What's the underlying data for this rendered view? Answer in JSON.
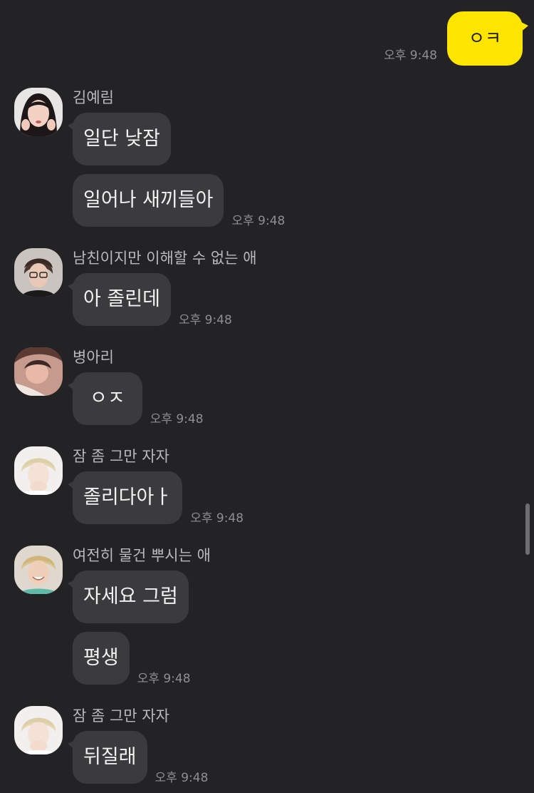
{
  "outgoing": {
    "text": "ㅇㅋ",
    "time": "오후 9:48"
  },
  "groups": [
    {
      "sender": "김예림",
      "avatar_icon": "profile-photo-girl",
      "messages": [
        {
          "text": "일단 낮잠",
          "time": ""
        },
        {
          "text": "일어나 새끼들아",
          "time": "오후 9:48"
        }
      ]
    },
    {
      "sender": "남친이지만 이해할 수 없는 애",
      "avatar_icon": "profile-photo-boy-glasses",
      "messages": [
        {
          "text": "아 졸린데",
          "time": "오후 9:48"
        }
      ]
    },
    {
      "sender": "병아리",
      "avatar_icon": "profile-photo-boy-lying",
      "messages": [
        {
          "text": "ㅇㅈ",
          "time": "오후 9:48"
        }
      ]
    },
    {
      "sender": "잠 좀 그만 자자",
      "avatar_icon": "profile-photo-blond",
      "messages": [
        {
          "text": "졸리다아ㅏ",
          "time": "오후 9:48"
        }
      ]
    },
    {
      "sender": "여전히 물건 뿌시는 애",
      "avatar_icon": "profile-photo-smile",
      "messages": [
        {
          "text": "자세요 그럼",
          "time": ""
        },
        {
          "text": "평생",
          "time": "오후 9:48"
        }
      ]
    },
    {
      "sender": "잠 좀 그만 자자",
      "avatar_icon": "profile-photo-blond",
      "messages": [
        {
          "text": "뒤질래",
          "time": "오후 9:48"
        }
      ]
    }
  ],
  "colors": {
    "background": "#232325",
    "outgoing_bubble": "#fee500",
    "incoming_bubble": "#3b3b3d",
    "time_text": "#8e8e93"
  }
}
